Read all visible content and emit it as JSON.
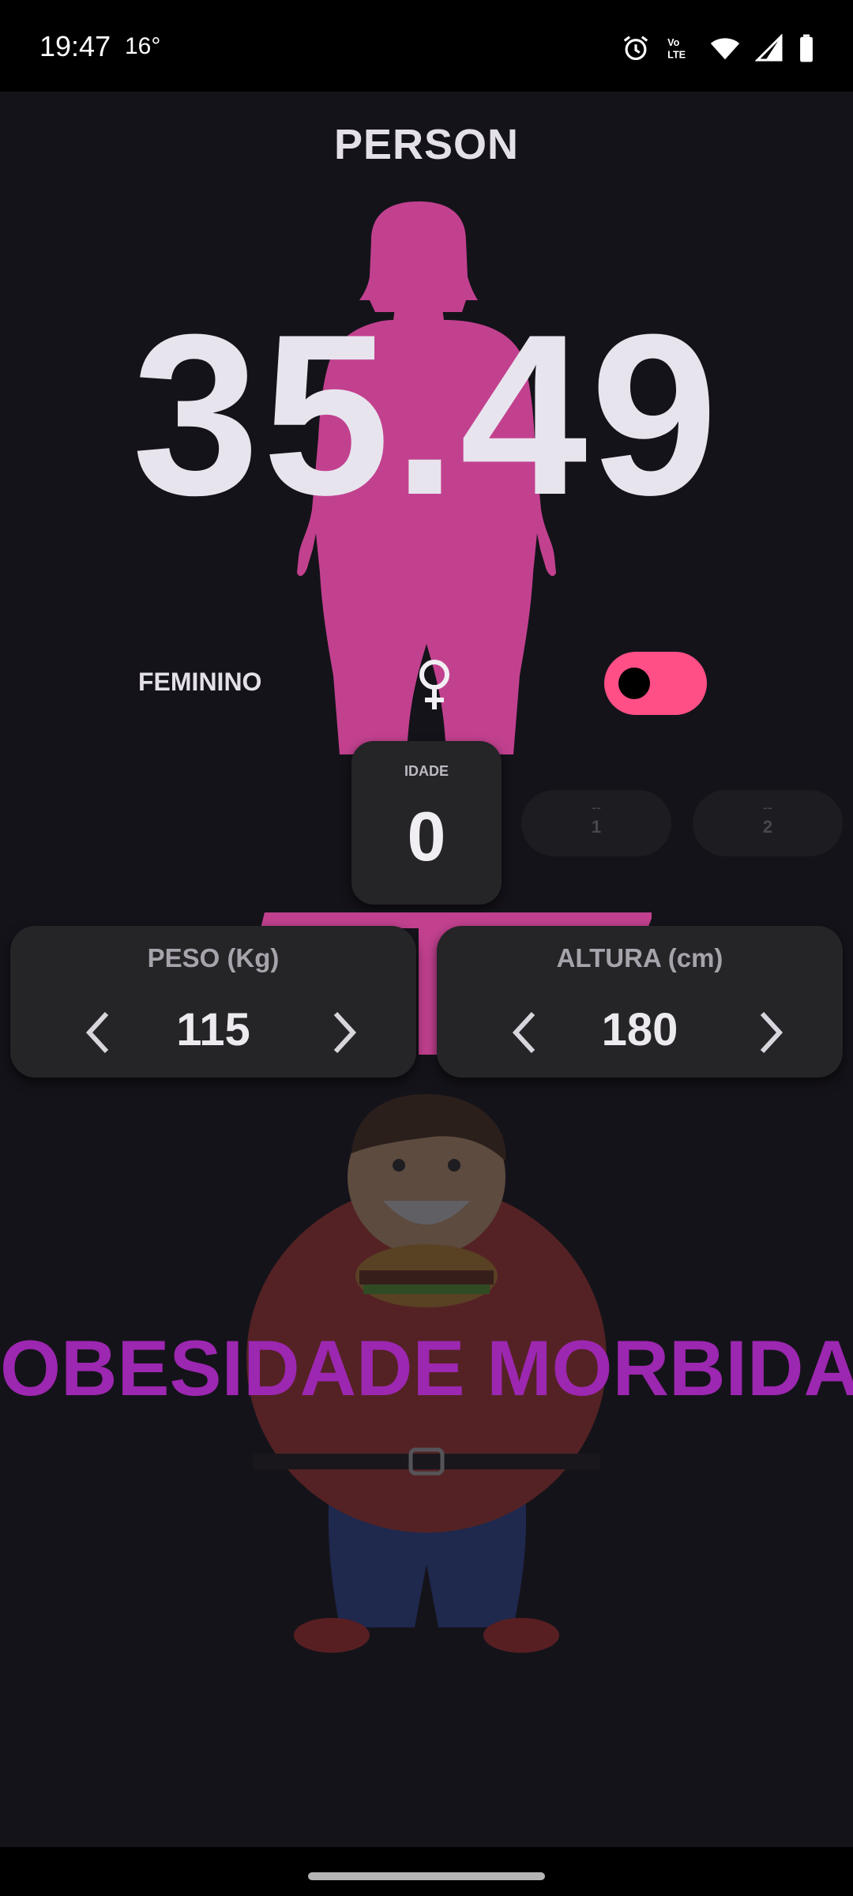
{
  "status_bar": {
    "time": "19:47",
    "temperature": "16°",
    "icons": [
      "alarm-icon",
      "volte-icon",
      "wifi-icon",
      "signal-icon",
      "battery-icon"
    ]
  },
  "app": {
    "title": "PERSON"
  },
  "bmi": {
    "value": "35.49"
  },
  "gender": {
    "label": "FEMININO",
    "icon": "female-symbol-icon",
    "toggle_on": true
  },
  "age": {
    "label": "IDADE",
    "value": "0",
    "next_values": [
      {
        "dash": "--",
        "value": "1"
      },
      {
        "dash": "--",
        "value": "2"
      }
    ]
  },
  "weight": {
    "label": "PESO (Kg)",
    "value": "115"
  },
  "height": {
    "label": "ALTURA (cm)",
    "value": "180"
  },
  "result": {
    "category": "OBESIDADE MORBIDA"
  },
  "colors": {
    "background": "#15131a",
    "accent_pink": "#ff4f86",
    "silhouette": "#c2418f",
    "category_purple": "#9c27b0",
    "card": "#252427"
  }
}
